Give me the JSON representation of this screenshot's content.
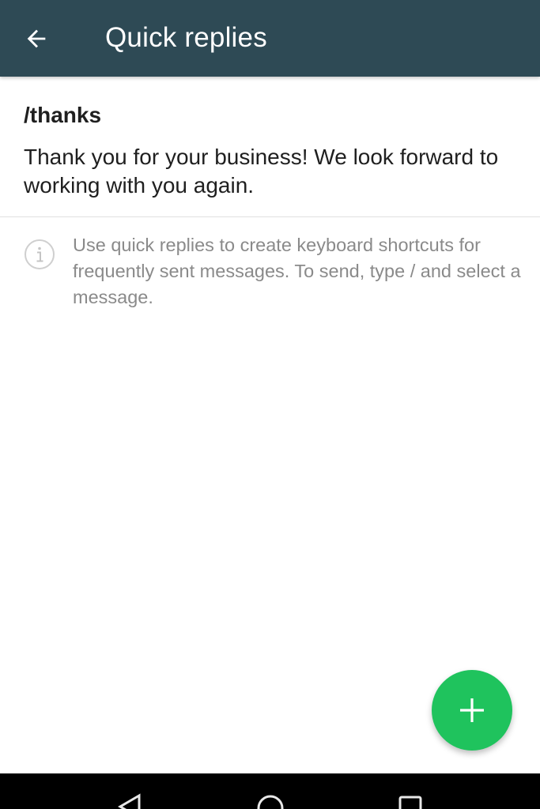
{
  "appbar": {
    "title": "Quick replies",
    "background": "#2e4a55",
    "back_icon": "arrow-left-icon"
  },
  "quick_replies": [
    {
      "shortcut": "/thanks",
      "message": "Thank you for your business! We look forward to working with you again."
    }
  ],
  "info": {
    "icon": "info-icon",
    "text": "Use quick replies to create keyboard shortcuts for frequently sent messages. To send, type / and select a message."
  },
  "fab": {
    "icon": "plus-icon",
    "color": "#1fc35d"
  },
  "navigation_bar": {
    "buttons": [
      "back-triangle-icon",
      "home-circle-icon",
      "recents-square-icon"
    ]
  }
}
